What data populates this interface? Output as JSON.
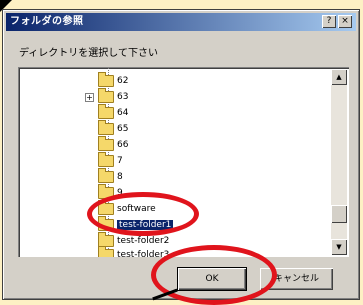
{
  "window": {
    "title": "フォルダの参照",
    "help_label": "?",
    "close_label": "×"
  },
  "instruction": "ディレクトリを選択して下さい",
  "tree": {
    "items": [
      {
        "label": "62",
        "selected": false,
        "has_expander": false
      },
      {
        "label": "63",
        "selected": false,
        "has_expander": true,
        "expander": "+"
      },
      {
        "label": "64",
        "selected": false,
        "has_expander": false
      },
      {
        "label": "65",
        "selected": false,
        "has_expander": false
      },
      {
        "label": "66",
        "selected": false,
        "has_expander": false
      },
      {
        "label": "7",
        "selected": false,
        "has_expander": false
      },
      {
        "label": "8",
        "selected": false,
        "has_expander": false
      },
      {
        "label": "9",
        "selected": false,
        "has_expander": false
      },
      {
        "label": "software",
        "selected": false,
        "has_expander": false
      },
      {
        "label": "test-folder1",
        "selected": true,
        "has_expander": false
      },
      {
        "label": "test-folder2",
        "selected": false,
        "has_expander": false
      },
      {
        "label": "test-folder3",
        "selected": false,
        "has_expander": false
      }
    ]
  },
  "scrollbar": {
    "up_icon": "▲",
    "down_icon": "▼"
  },
  "buttons": {
    "ok_label": "OK",
    "cancel_label": "キャンセル"
  },
  "colors": {
    "highlight_ring": "#e0141c",
    "selection": "#0a246a",
    "titlebar": "#0a246a"
  }
}
